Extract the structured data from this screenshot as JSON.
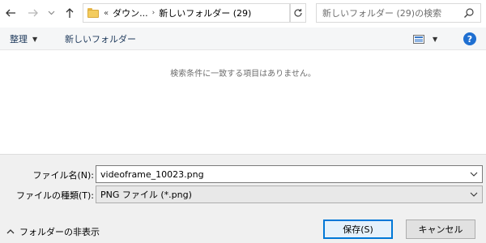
{
  "address_bar": {
    "overflow_chevron": "«",
    "crumbs": [
      "ダウン...",
      "新しいフォルダー (29)"
    ],
    "separator": "›",
    "refresh_icon": "refresh-icon",
    "search_placeholder": "新しいフォルダー (29)の検索"
  },
  "toolbar": {
    "organize_label": "整理",
    "new_folder_label": "新しいフォルダー",
    "help_label": "?"
  },
  "content": {
    "empty_message": "検索条件に一致する項目はありません。"
  },
  "bottom": {
    "file_name_label": "ファイル名(N):",
    "file_name_value": "videoframe_10023.png",
    "file_type_label": "ファイルの種類(T):",
    "file_type_value": "PNG ファイル (*.png)",
    "hide_folders_label": "フォルダーの非表示",
    "save_label": "保存(S)",
    "cancel_label": "キャンセル"
  },
  "colors": {
    "accent": "#0078d7",
    "toolbar_text": "#1e395b",
    "help_icon_bg": "#1f6fd1",
    "folder_yellow": "#f3cc5e"
  }
}
